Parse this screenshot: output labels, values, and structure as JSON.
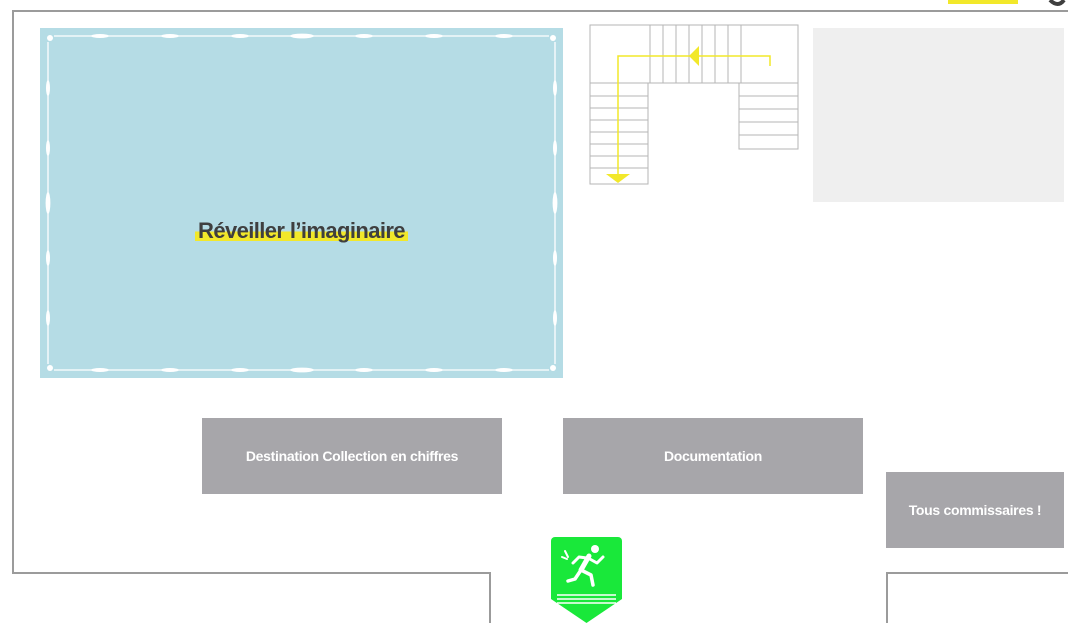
{
  "floorplan": {
    "room": {
      "title": "Réveiller l’imaginaire",
      "bg_color": "#b5dce5",
      "highlight_color": "#f2e82a"
    },
    "buttons": [
      {
        "label": "Destination Collection en chiffres"
      },
      {
        "label": "Documentation"
      },
      {
        "label": "Tous commissaires !"
      }
    ],
    "button_color": "#a7a6aa",
    "stairs": {
      "arrow_color": "#f2e82a"
    },
    "exit": {
      "icon": "emergency-exit-icon",
      "color": "#19e83a"
    },
    "wall_color": "#9b9b9b"
  }
}
